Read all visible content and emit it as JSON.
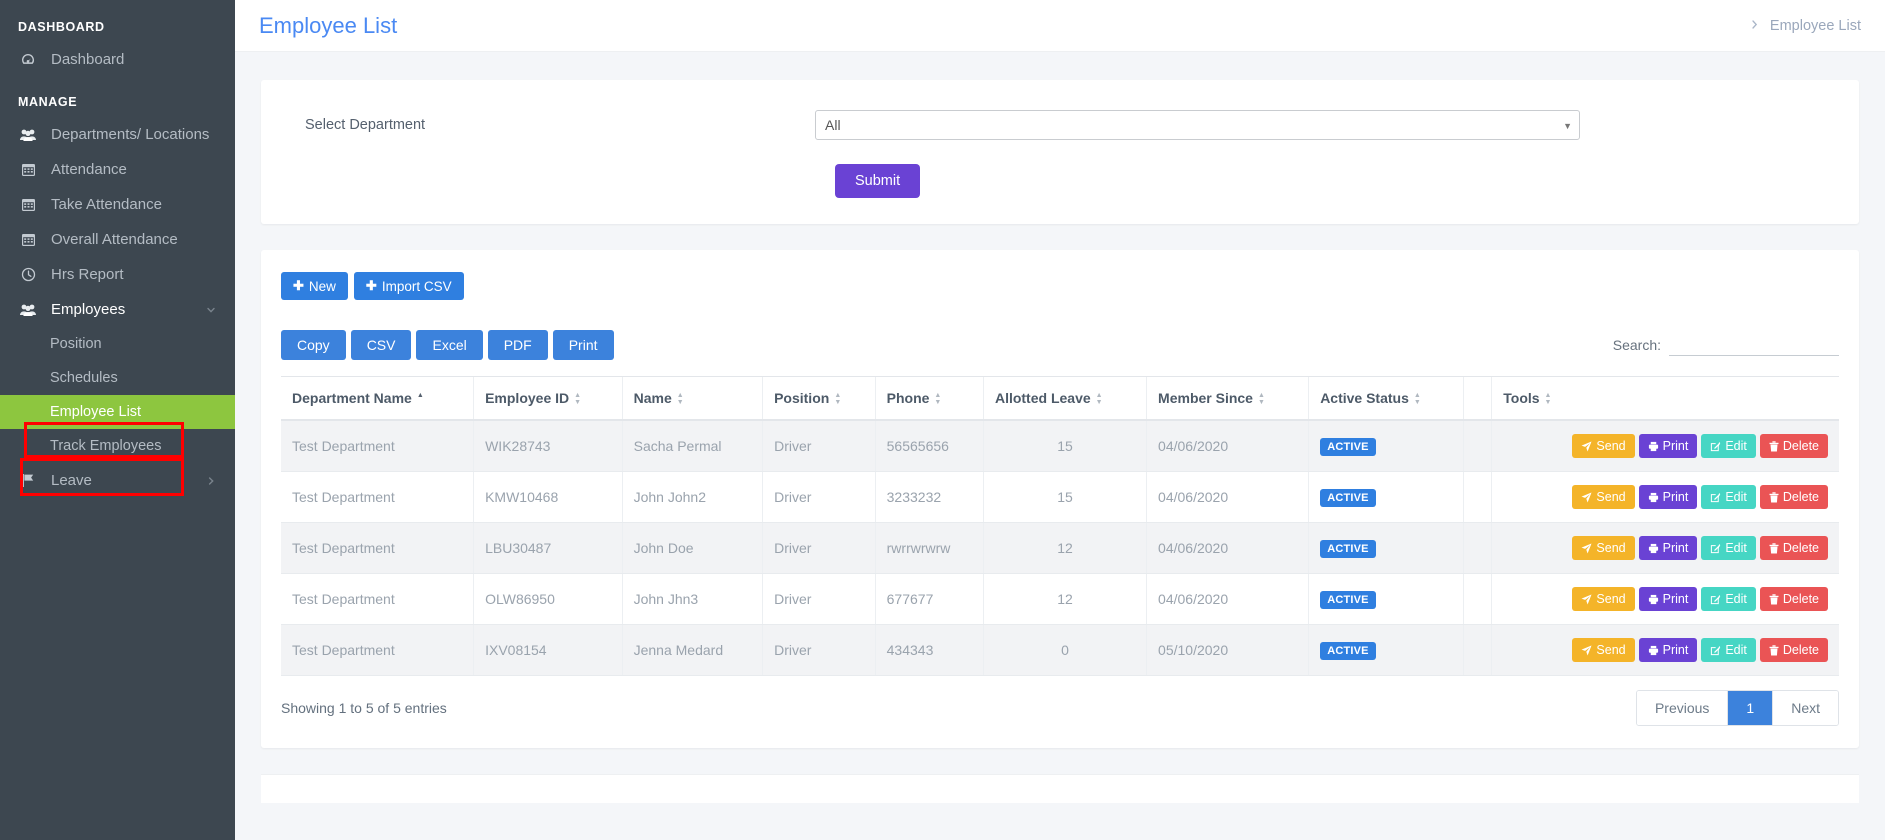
{
  "sidebar": {
    "heading_dashboard": "DASHBOARD",
    "heading_manage": "MANAGE",
    "dashboard_item": {
      "label": "Dashboard",
      "icon": "speedometer-icon"
    },
    "items": [
      {
        "label": "Departments/ Locations",
        "icon": "users-icon"
      },
      {
        "label": "Attendance",
        "icon": "calendar-icon"
      },
      {
        "label": "Take Attendance",
        "icon": "calendar-icon"
      },
      {
        "label": "Overall Attendance",
        "icon": "calendar-icon"
      },
      {
        "label": "Hrs Report",
        "icon": "clock-icon"
      }
    ],
    "employees": {
      "label": "Employees",
      "icon": "users-icon",
      "chevron": "chevron-down-icon"
    },
    "employees_sub": [
      {
        "label": "Position",
        "active": false
      },
      {
        "label": "Schedules",
        "active": false
      },
      {
        "label": "Employee List",
        "active": true
      },
      {
        "label": "Track Employees",
        "active": false
      }
    ],
    "leave": {
      "label": "Leave",
      "icon": "flag-icon",
      "chevron": "chevron-right-icon"
    },
    "active_color": "#8dc63f",
    "bg_color": "#3d4750"
  },
  "header": {
    "title": "Employee List",
    "breadcrumb_icon": "chevron-right-icon",
    "breadcrumb": "Employee List",
    "title_color": "#4a89f3"
  },
  "filter": {
    "label": "Select Department",
    "selected": "All",
    "options": [
      "All"
    ],
    "dropdown_icon": "caret-down-icon",
    "submit_label": "Submit",
    "submit_color": "#6a42d4"
  },
  "toolbar": {
    "new_label": "New",
    "import_label": "Import CSV",
    "plus_icon": "plus-icon"
  },
  "export": {
    "buttons": [
      "Copy",
      "CSV",
      "Excel",
      "PDF",
      "Print"
    ]
  },
  "search": {
    "label": "Search:",
    "value": "",
    "placeholder": ""
  },
  "table": {
    "columns": [
      {
        "label": "Department Name",
        "sort": "asc"
      },
      {
        "label": "Employee ID",
        "sort": "none"
      },
      {
        "label": "Name",
        "sort": "none"
      },
      {
        "label": "Position",
        "sort": "none"
      },
      {
        "label": "Phone",
        "sort": "none"
      },
      {
        "label": "Allotted Leave",
        "sort": "none"
      },
      {
        "label": "Member Since",
        "sort": "none"
      },
      {
        "label": "Active Status",
        "sort": "none"
      },
      {
        "label": "",
        "sort": "none"
      },
      {
        "label": "Tools",
        "sort": "none"
      }
    ],
    "rows": [
      {
        "department": "Test Department",
        "employee_id": "WIK28743",
        "name": "Sacha Permal",
        "position": "Driver",
        "phone": "56565656",
        "allotted_leave": "15",
        "member_since": "04/06/2020",
        "status": "ACTIVE"
      },
      {
        "department": "Test Department",
        "employee_id": "KMW10468",
        "name": "John John2",
        "position": "Driver",
        "phone": "3233232",
        "allotted_leave": "15",
        "member_since": "04/06/2020",
        "status": "ACTIVE"
      },
      {
        "department": "Test Department",
        "employee_id": "LBU30487",
        "name": "John Doe",
        "position": "Driver",
        "phone": "rwrrwrwrw",
        "allotted_leave": "12",
        "member_since": "04/06/2020",
        "status": "ACTIVE"
      },
      {
        "department": "Test Department",
        "employee_id": "OLW86950",
        "name": "John Jhn3",
        "position": "Driver",
        "phone": "677677",
        "allotted_leave": "12",
        "member_since": "04/06/2020",
        "status": "ACTIVE"
      },
      {
        "department": "Test Department",
        "employee_id": "IXV08154",
        "name": "Jenna Medard",
        "position": "Driver",
        "phone": "434343",
        "allotted_leave": "0",
        "member_since": "05/10/2020",
        "status": "ACTIVE"
      }
    ],
    "actions": [
      {
        "label": "Send",
        "icon": "paper-plane-icon",
        "color": "#f4b429"
      },
      {
        "label": "Print",
        "icon": "printer-icon",
        "color": "#6a42d4"
      },
      {
        "label": "Edit",
        "icon": "pencil-icon",
        "color": "#46d6c4"
      },
      {
        "label": "Delete",
        "icon": "trash-icon",
        "color": "#ea5455"
      }
    ],
    "status_badge_color": "#2f7fe0"
  },
  "footer_table": {
    "info": "Showing 1 to 5 of 5 entries",
    "pagination": {
      "previous": "Previous",
      "pages": [
        "1"
      ],
      "current": "1",
      "next": "Next"
    }
  }
}
